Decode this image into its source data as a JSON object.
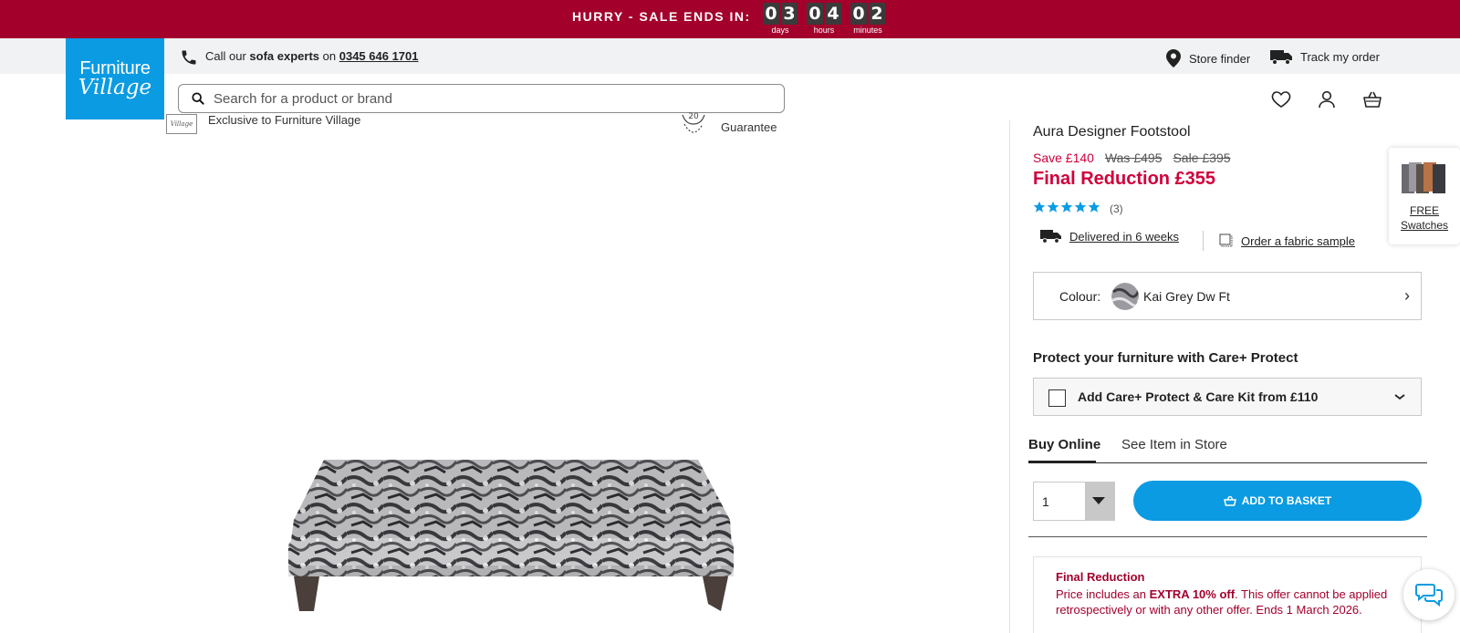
{
  "sale_banner": {
    "text": "HURRY - SALE ENDS IN:",
    "countdown": [
      {
        "digits": [
          "0",
          "3"
        ],
        "label": "days"
      },
      {
        "digits": [
          "0",
          "4"
        ],
        "label": "hours"
      },
      {
        "digits": [
          "0",
          "2"
        ],
        "label": "minutes"
      }
    ]
  },
  "utility_bar": {
    "call_prefix": "Call our",
    "call_bold": "sofa experts",
    "call_on": "on",
    "phone": "0345 646 1701",
    "store_finder": "Store finder",
    "track_order": "Track my order"
  },
  "logo": {
    "line1": "Furniture",
    "line2": "Village"
  },
  "search": {
    "placeholder": "Search for a product or brand"
  },
  "gallery": {
    "usp_exclusive": "Exclusive to Furniture Village",
    "usp_badge_number": "20",
    "usp_guarantee": "Guarantee",
    "logo_mini": "Village"
  },
  "product": {
    "title": "Aura Designer Footstool",
    "save": "Save £140",
    "was": "Was £495",
    "sale": "Sale £395",
    "final_price": "Final Reduction £355",
    "rating": 5,
    "review_count": "(3)",
    "delivery": "Delivered in 6 weeks",
    "fabric_sample": "Order a fabric sample",
    "colour_label": "Colour:",
    "colour_value": "Kai Grey Dw Ft",
    "protect_title": "Protect your furniture with Care+ Protect",
    "protect_option": "Add Care+ Protect & Care Kit from £110",
    "tabs": [
      {
        "label": "Buy Online",
        "active": true
      },
      {
        "label": "See Item in Store",
        "active": false
      }
    ],
    "quantity": "1",
    "add_to_basket": "ADD TO BASKET",
    "offer_title": "Final Reduction",
    "offer_text_1": "Price includes an ",
    "offer_text_bold": "EXTRA 10% off",
    "offer_text_2": ". This offer cannot be applied retrospectively or with any other offer. Ends 1 March 2026."
  },
  "swatches": {
    "line1": "FREE",
    "line2": "Swatches"
  },
  "colors": {
    "banner": "#a3002c",
    "brand_blue": "#0a9be3",
    "price_red": "#d0003b",
    "utility_bg": "#f1f2f4"
  },
  "icons": {
    "phone": "phone-icon",
    "store": "location-pin-icon",
    "track": "delivery-truck-icon",
    "search": "search-icon",
    "wishlist": "heart-icon",
    "account": "user-icon",
    "basket": "basket-icon",
    "chat": "chat-icon"
  }
}
